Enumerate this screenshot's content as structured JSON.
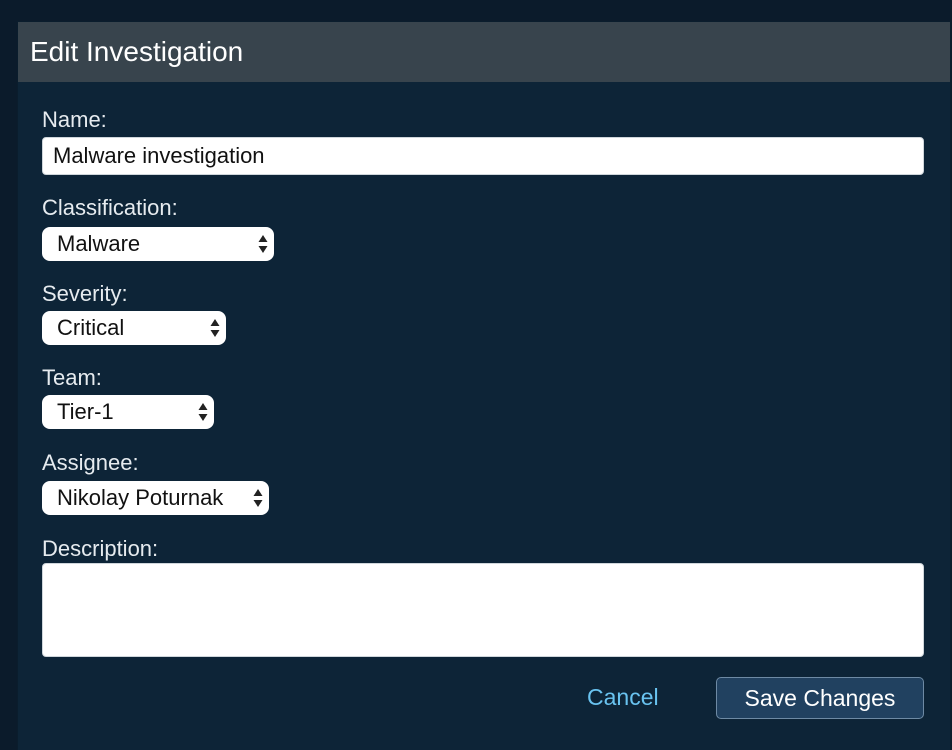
{
  "dialog": {
    "title": "Edit Investigation"
  },
  "fields": {
    "name": {
      "label": "Name:",
      "value": "Malware investigation"
    },
    "classification": {
      "label": "Classification:",
      "selected": "Malware"
    },
    "severity": {
      "label": "Severity:",
      "selected": "Critical"
    },
    "team": {
      "label": "Team:",
      "selected": "Tier-1"
    },
    "assignee": {
      "label": "Assignee:",
      "selected": "Nikolay Poturnak"
    },
    "description": {
      "label": "Description:",
      "value": ""
    }
  },
  "actions": {
    "cancel_label": "Cancel",
    "save_label": "Save Changes"
  },
  "colors": {
    "backdrop": "#0b1b2b",
    "panel": "#0d2437",
    "header": "#38444d",
    "link": "#69c3f0",
    "button": "#214160"
  },
  "icons": {
    "select_arrows": "select-arrows-icon"
  }
}
